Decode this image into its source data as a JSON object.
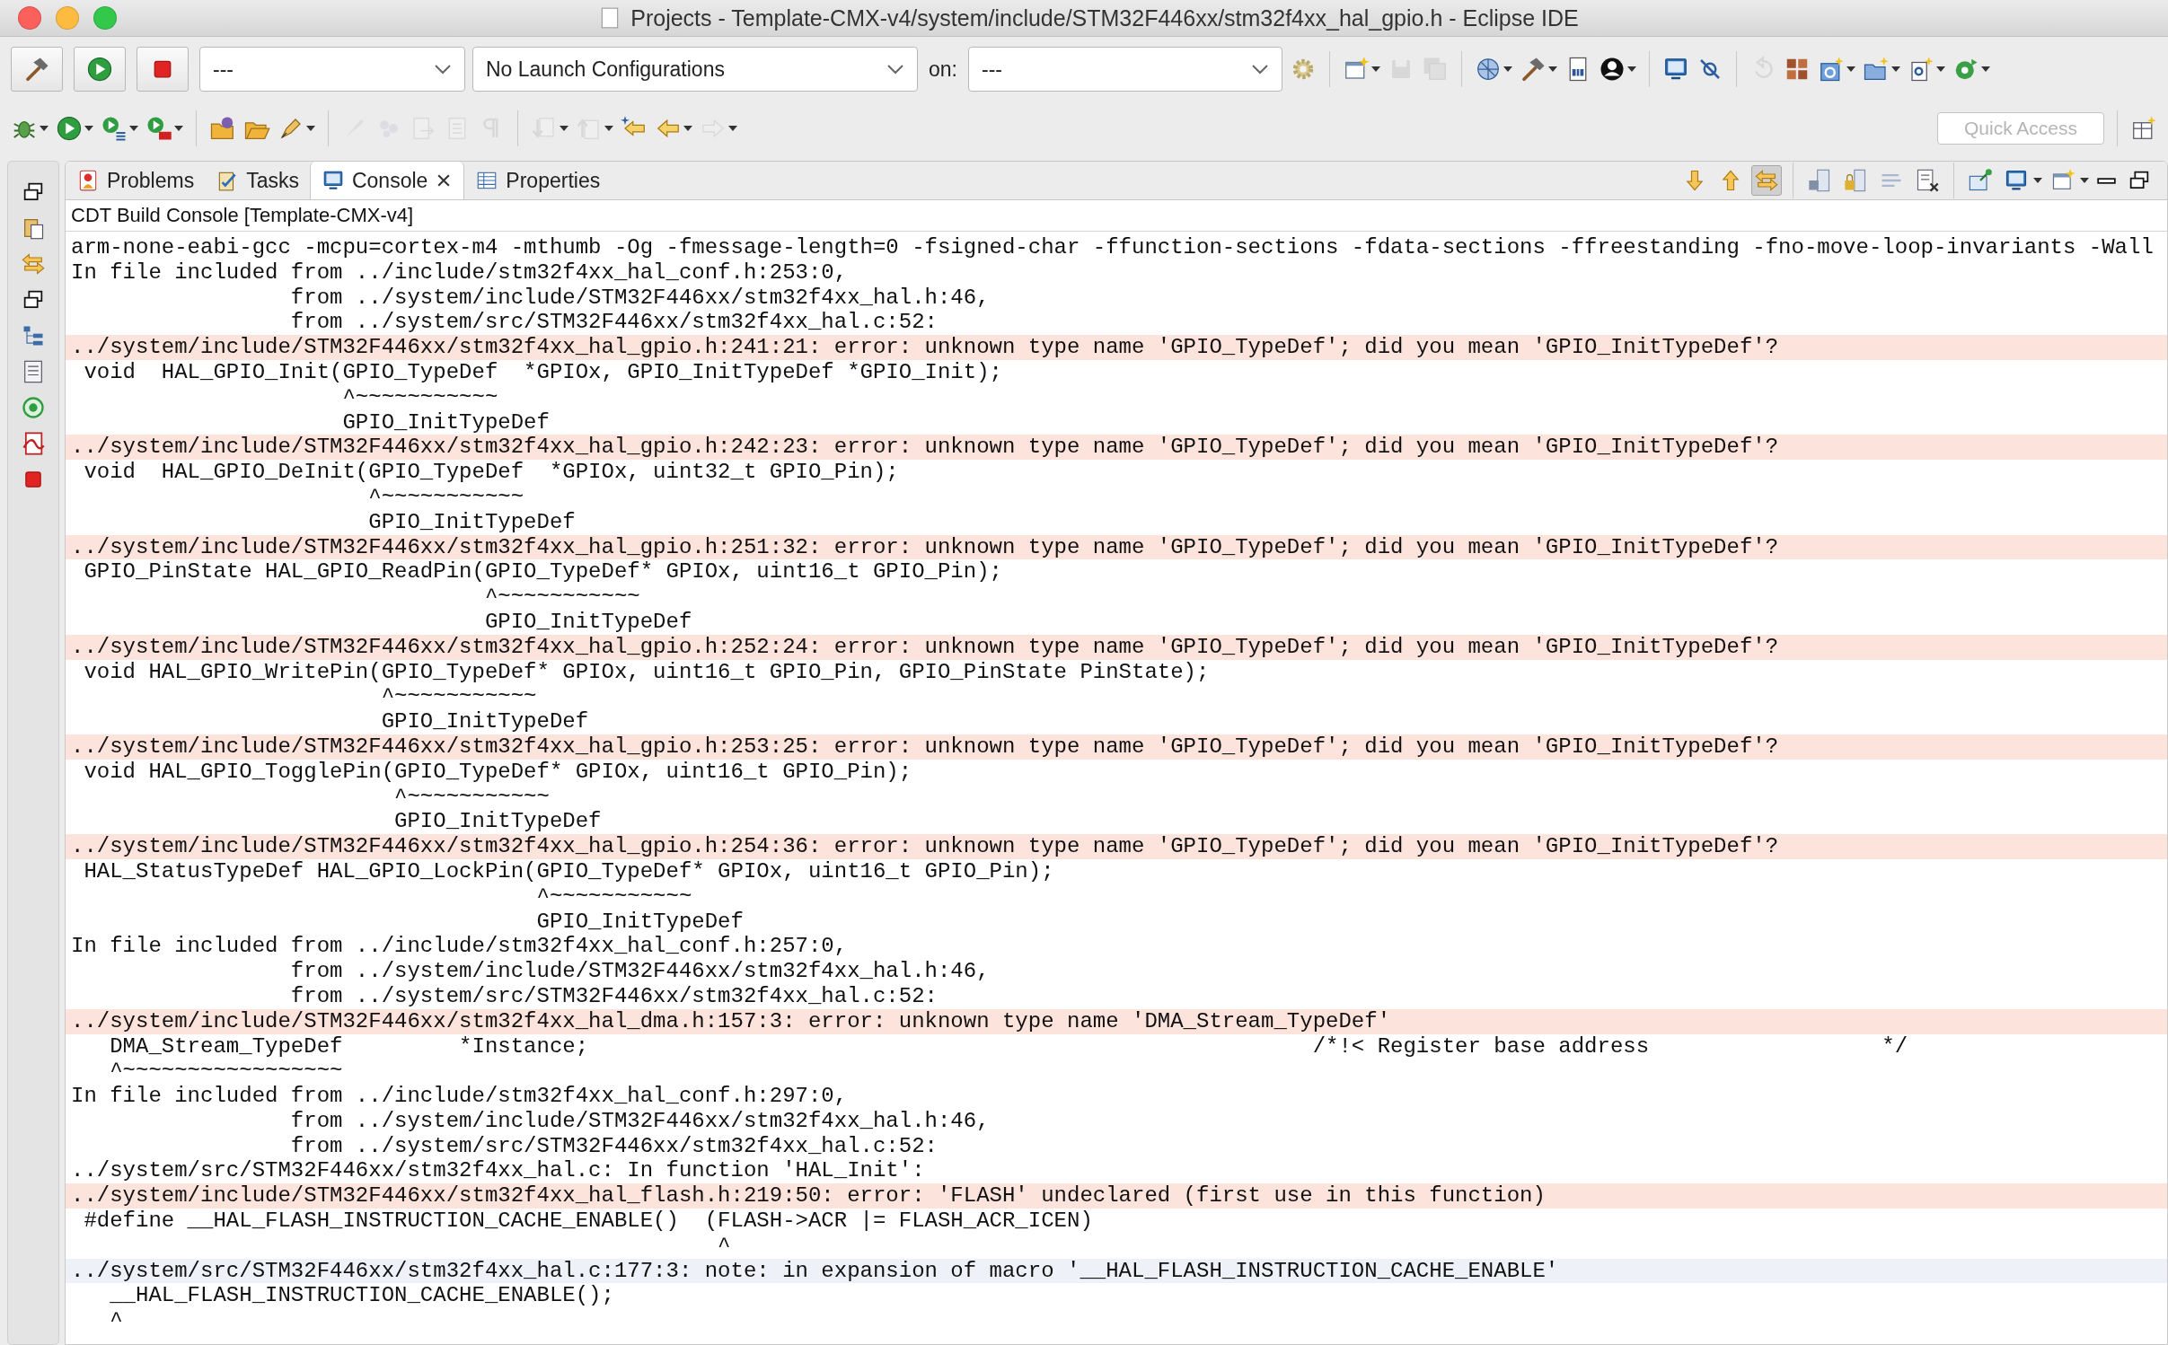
{
  "window": {
    "title": "Projects - Template-CMX-v4/system/include/STM32F446xx/stm32f4xx_hal_gpio.h - Eclipse IDE"
  },
  "launch_bar": {
    "buttons": [
      {
        "kind": "hammer"
      },
      {
        "kind": "play-circle"
      },
      {
        "kind": "stop-square"
      }
    ],
    "mode": "---",
    "configuration": "No Launch Configurations",
    "target_label": "on:",
    "target": "---"
  },
  "main_toolbar": [
    {
      "kind": "new-window",
      "dropdown": true,
      "disabled": false
    },
    {
      "kind": "floppy",
      "dropdown": false,
      "disabled": true
    },
    {
      "kind": "floppy-stack",
      "dropdown": false,
      "disabled": true
    },
    {
      "kind": "sep"
    },
    {
      "kind": "globe",
      "dropdown": true,
      "disabled": false
    },
    {
      "kind": "hammer",
      "dropdown": true,
      "disabled": false
    },
    {
      "kind": "binary-doc",
      "dropdown": false,
      "disabled": false
    },
    {
      "kind": "person-circle",
      "dropdown": true,
      "disabled": false
    },
    {
      "kind": "sep"
    },
    {
      "kind": "monitor",
      "dropdown": false,
      "disabled": false
    },
    {
      "kind": "unlink",
      "dropdown": false,
      "disabled": false
    },
    {
      "kind": "sep"
    },
    {
      "kind": "refresh-arrow",
      "dropdown": false,
      "disabled": true
    },
    {
      "kind": "bricks",
      "dropdown": false,
      "disabled": false
    },
    {
      "kind": "class-box",
      "dropdown": true,
      "disabled": false
    },
    {
      "kind": "folder-star",
      "dropdown": true,
      "disabled": false
    },
    {
      "kind": "doc-star",
      "dropdown": true,
      "disabled": false
    },
    {
      "kind": "refresh-circle",
      "dropdown": true,
      "disabled": false
    }
  ],
  "second_toolbar": [
    {
      "kind": "bug",
      "dropdown": true,
      "disabled": false
    },
    {
      "kind": "play-circle",
      "dropdown": true,
      "disabled": false
    },
    {
      "kind": "run-list",
      "dropdown": true,
      "disabled": false
    },
    {
      "kind": "run-toolbox",
      "dropdown": true,
      "disabled": false
    },
    {
      "kind": "sep"
    },
    {
      "kind": "folder-globe",
      "dropdown": false,
      "disabled": false
    },
    {
      "kind": "folder-open",
      "dropdown": false,
      "disabled": false
    },
    {
      "kind": "pen",
      "dropdown": true,
      "disabled": false
    },
    {
      "kind": "sep"
    },
    {
      "kind": "brush",
      "dropdown": false,
      "disabled": true
    },
    {
      "kind": "circles",
      "dropdown": false,
      "disabled": true
    },
    {
      "kind": "doc-arrow",
      "dropdown": false,
      "disabled": true
    },
    {
      "kind": "doc-lines",
      "dropdown": false,
      "disabled": true
    },
    {
      "kind": "pilcrow",
      "dropdown": false,
      "disabled": true
    },
    {
      "kind": "sep"
    },
    {
      "kind": "arrow-down-doc",
      "dropdown": true,
      "disabled": true
    },
    {
      "kind": "arrow-up-doc",
      "dropdown": true,
      "disabled": true
    },
    {
      "kind": "star-arrow-left",
      "dropdown": false,
      "disabled": false
    },
    {
      "kind": "arrow-left",
      "dropdown": true,
      "disabled": false
    },
    {
      "kind": "arrow-right",
      "dropdown": true,
      "disabled": true
    }
  ],
  "quick_access": {
    "placeholder": "Quick Access"
  },
  "side_trim": [
    {
      "kind": "restore-windows"
    },
    {
      "kind": "clipboard-doc"
    },
    {
      "kind": "swap-arrows"
    },
    {
      "kind": "restore-windows"
    },
    {
      "kind": "tree-list"
    },
    {
      "kind": "doc-page"
    },
    {
      "kind": "target"
    },
    {
      "kind": "pdf-doc"
    },
    {
      "kind": "stop-square"
    }
  ],
  "tabs": [
    {
      "label": "Problems",
      "selected": false
    },
    {
      "label": "Tasks",
      "selected": false
    },
    {
      "label": "Console",
      "selected": true
    },
    {
      "label": "Properties",
      "selected": false
    }
  ],
  "view_toolbar": [
    {
      "kind": "arrow-down",
      "dropdown": false,
      "selected": false
    },
    {
      "kind": "arrow-up",
      "dropdown": false,
      "selected": false
    },
    {
      "kind": "swap-arrows",
      "dropdown": false,
      "selected": true
    },
    {
      "kind": "sep"
    },
    {
      "kind": "doc-save",
      "dropdown": false,
      "selected": false
    },
    {
      "kind": "doc-lock",
      "dropdown": false,
      "selected": false
    },
    {
      "kind": "lines",
      "dropdown": false,
      "selected": false
    },
    {
      "kind": "doc-x",
      "dropdown": false,
      "selected": false
    },
    {
      "kind": "sep"
    },
    {
      "kind": "pin",
      "dropdown": false,
      "selected": false
    },
    {
      "kind": "monitor",
      "dropdown": true,
      "selected": false
    },
    {
      "kind": "new-window",
      "dropdown": true,
      "selected": false
    },
    {
      "kind": "minimize-bar",
      "dropdown": false,
      "selected": false
    },
    {
      "kind": "restore-windows",
      "dropdown": false,
      "selected": false
    }
  ],
  "console": {
    "title": "CDT Build Console [Template-CMX-v4]",
    "lines": [
      {
        "kind": "plain",
        "text": "arm-none-eabi-gcc -mcpu=cortex-m4 -mthumb -Og -fmessage-length=0 -fsigned-char -ffunction-sections -fdata-sections -ffreestanding -fno-move-loop-invariants -Wall"
      },
      {
        "kind": "plain",
        "text": "In file included from ../include/stm32f4xx_hal_conf.h:253:0,"
      },
      {
        "kind": "plain",
        "text": "                 from ../system/include/STM32F446xx/stm32f4xx_hal.h:46,"
      },
      {
        "kind": "plain",
        "text": "                 from ../system/src/STM32F446xx/stm32f4xx_hal.c:52:"
      },
      {
        "kind": "error",
        "text": "../system/include/STM32F446xx/stm32f4xx_hal_gpio.h:241:21: error: unknown type name 'GPIO_TypeDef'; did you mean 'GPIO_InitTypeDef'?"
      },
      {
        "kind": "plain",
        "text": " void  HAL_GPIO_Init(GPIO_TypeDef  *GPIOx, GPIO_InitTypeDef *GPIO_Init);"
      },
      {
        "kind": "plain",
        "text": "                     ^~~~~~~~~~~~"
      },
      {
        "kind": "plain",
        "text": "                     GPIO_InitTypeDef"
      },
      {
        "kind": "error",
        "text": "../system/include/STM32F446xx/stm32f4xx_hal_gpio.h:242:23: error: unknown type name 'GPIO_TypeDef'; did you mean 'GPIO_InitTypeDef'?"
      },
      {
        "kind": "plain",
        "text": " void  HAL_GPIO_DeInit(GPIO_TypeDef  *GPIOx, uint32_t GPIO_Pin);"
      },
      {
        "kind": "plain",
        "text": "                       ^~~~~~~~~~~~"
      },
      {
        "kind": "plain",
        "text": "                       GPIO_InitTypeDef"
      },
      {
        "kind": "error",
        "text": "../system/include/STM32F446xx/stm32f4xx_hal_gpio.h:251:32: error: unknown type name 'GPIO_TypeDef'; did you mean 'GPIO_InitTypeDef'?"
      },
      {
        "kind": "plain",
        "text": " GPIO_PinState HAL_GPIO_ReadPin(GPIO_TypeDef* GPIOx, uint16_t GPIO_Pin);"
      },
      {
        "kind": "plain",
        "text": "                                ^~~~~~~~~~~~"
      },
      {
        "kind": "plain",
        "text": "                                GPIO_InitTypeDef"
      },
      {
        "kind": "error",
        "text": "../system/include/STM32F446xx/stm32f4xx_hal_gpio.h:252:24: error: unknown type name 'GPIO_TypeDef'; did you mean 'GPIO_InitTypeDef'?"
      },
      {
        "kind": "plain",
        "text": " void HAL_GPIO_WritePin(GPIO_TypeDef* GPIOx, uint16_t GPIO_Pin, GPIO_PinState PinState);"
      },
      {
        "kind": "plain",
        "text": "                        ^~~~~~~~~~~~"
      },
      {
        "kind": "plain",
        "text": "                        GPIO_InitTypeDef"
      },
      {
        "kind": "error",
        "text": "../system/include/STM32F446xx/stm32f4xx_hal_gpio.h:253:25: error: unknown type name 'GPIO_TypeDef'; did you mean 'GPIO_InitTypeDef'?"
      },
      {
        "kind": "plain",
        "text": " void HAL_GPIO_TogglePin(GPIO_TypeDef* GPIOx, uint16_t GPIO_Pin);"
      },
      {
        "kind": "plain",
        "text": "                         ^~~~~~~~~~~~"
      },
      {
        "kind": "plain",
        "text": "                         GPIO_InitTypeDef"
      },
      {
        "kind": "error",
        "text": "../system/include/STM32F446xx/stm32f4xx_hal_gpio.h:254:36: error: unknown type name 'GPIO_TypeDef'; did you mean 'GPIO_InitTypeDef'?"
      },
      {
        "kind": "plain",
        "text": " HAL_StatusTypeDef HAL_GPIO_LockPin(GPIO_TypeDef* GPIOx, uint16_t GPIO_Pin);"
      },
      {
        "kind": "plain",
        "text": "                                    ^~~~~~~~~~~~"
      },
      {
        "kind": "plain",
        "text": "                                    GPIO_InitTypeDef"
      },
      {
        "kind": "plain",
        "text": "In file included from ../include/stm32f4xx_hal_conf.h:257:0,"
      },
      {
        "kind": "plain",
        "text": "                 from ../system/include/STM32F446xx/stm32f4xx_hal.h:46,"
      },
      {
        "kind": "plain",
        "text": "                 from ../system/src/STM32F446xx/stm32f4xx_hal.c:52:"
      },
      {
        "kind": "error",
        "text": "../system/include/STM32F446xx/stm32f4xx_hal_dma.h:157:3: error: unknown type name 'DMA_Stream_TypeDef'"
      },
      {
        "kind": "plain",
        "text": "   DMA_Stream_TypeDef         *Instance;                                                        /*!< Register base address                  */"
      },
      {
        "kind": "plain",
        "text": "   ^~~~~~~~~~~~~~~~~~"
      },
      {
        "kind": "plain",
        "text": "In file included from ../include/stm32f4xx_hal_conf.h:297:0,"
      },
      {
        "kind": "plain",
        "text": "                 from ../system/include/STM32F446xx/stm32f4xx_hal.h:46,"
      },
      {
        "kind": "plain",
        "text": "                 from ../system/src/STM32F446xx/stm32f4xx_hal.c:52:"
      },
      {
        "kind": "plain",
        "text": "../system/src/STM32F446xx/stm32f4xx_hal.c: In function 'HAL_Init':"
      },
      {
        "kind": "error",
        "text": "../system/include/STM32F446xx/stm32f4xx_hal_flash.h:219:50: error: 'FLASH' undeclared (first use in this function)"
      },
      {
        "kind": "plain",
        "text": " #define __HAL_FLASH_INSTRUCTION_CACHE_ENABLE()  (FLASH->ACR |= FLASH_ACR_ICEN)"
      },
      {
        "kind": "plain",
        "text": "                                                  ^"
      },
      {
        "kind": "note",
        "text": "../system/src/STM32F446xx/stm32f4xx_hal.c:177:3: note: in expansion of macro '__HAL_FLASH_INSTRUCTION_CACHE_ENABLE'"
      },
      {
        "kind": "plain",
        "text": "   __HAL_FLASH_INSTRUCTION_CACHE_ENABLE();"
      },
      {
        "kind": "plain",
        "text": "   ^"
      }
    ]
  }
}
